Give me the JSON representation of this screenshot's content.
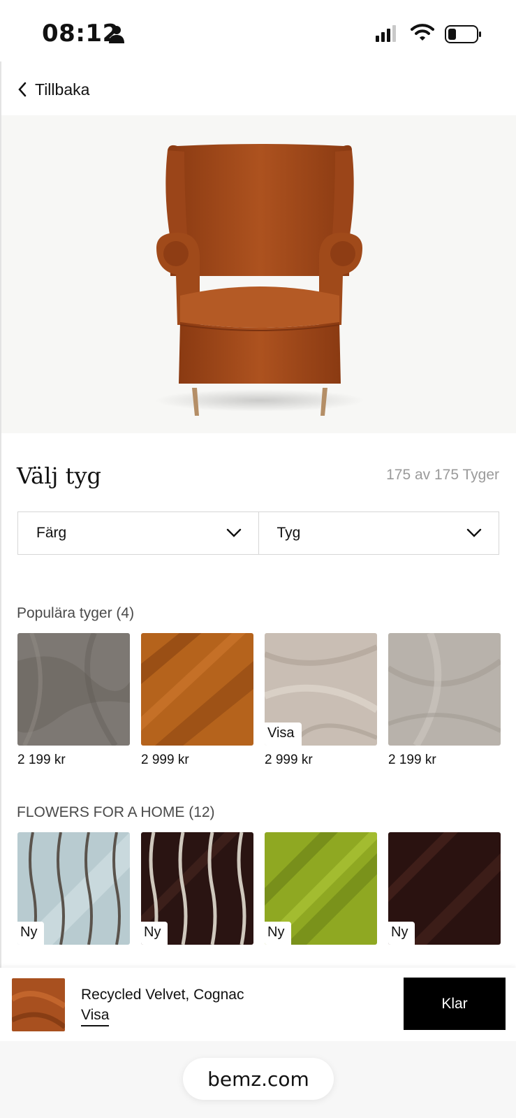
{
  "status_bar": {
    "time": "08:12"
  },
  "nav": {
    "back_label": "Tillbaka"
  },
  "fabric_section": {
    "title": "Välj tyg",
    "count": "175 av 175 Tyger",
    "filters": [
      {
        "label": "Färg"
      },
      {
        "label": "Tyg"
      }
    ]
  },
  "groups": [
    {
      "title": "Populära tyger (4)",
      "items": [
        {
          "price": "2 199 kr",
          "tag": "",
          "color": "#7d7873"
        },
        {
          "price": "2 999 kr",
          "tag": "",
          "color": "#b5631c"
        },
        {
          "price": "2 999 kr",
          "tag": "Visa",
          "color": "#c9beb4"
        },
        {
          "price": "2 199 kr",
          "tag": "",
          "color": "#b8b2ab"
        }
      ]
    },
    {
      "title": "FLOWERS FOR A HOME (12)",
      "items": [
        {
          "price": "",
          "tag": "Ny",
          "color": "#b8cbd0"
        },
        {
          "price": "",
          "tag": "Ny",
          "color": "#2a1412"
        },
        {
          "price": "",
          "tag": "Ny",
          "color": "#8fa822"
        },
        {
          "price": "",
          "tag": "Ny",
          "color": "#2a1210"
        }
      ]
    }
  ],
  "selection": {
    "name": "Recycled Velvet, Cognac",
    "link_label": "Visa",
    "done_label": "Klar",
    "color": "#a8501f"
  },
  "browser": {
    "url": "bemz.com"
  },
  "colors": {
    "chair": "#a84c1c",
    "chair_dark": "#7e3510",
    "legs": "#b8946c"
  }
}
